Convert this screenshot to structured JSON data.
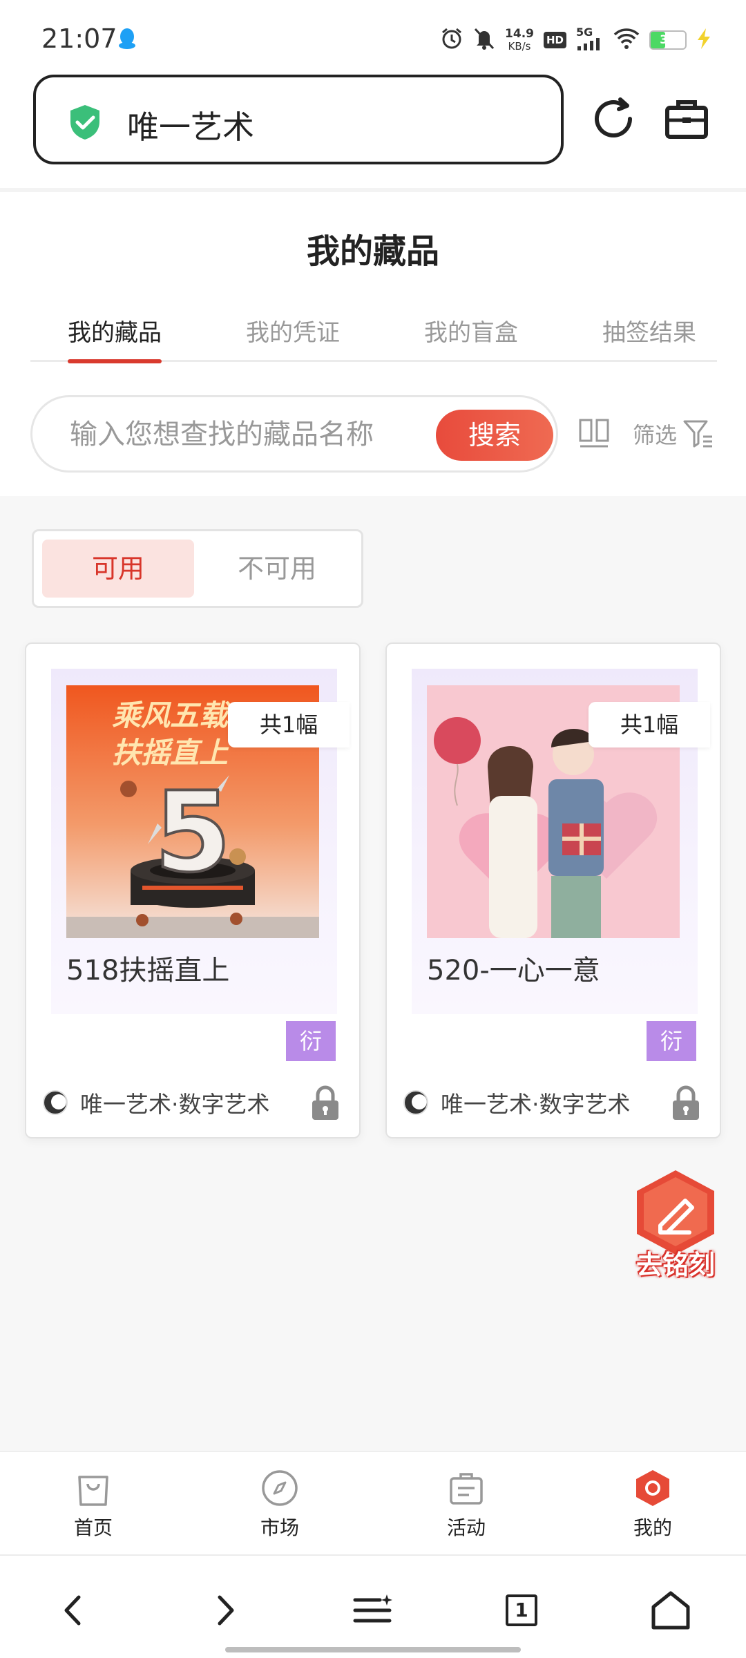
{
  "status_bar": {
    "time": "21:07",
    "speed_value": "14.9",
    "speed_unit": "KB/s",
    "hd_label": "HD",
    "network_label": "5G",
    "battery_level": "35",
    "icons": [
      "qq-icon",
      "alarm-icon",
      "mute-icon",
      "signal-icon",
      "wifi-icon",
      "battery-icon",
      "charging-icon"
    ]
  },
  "browser": {
    "site_title": "唯一艺术",
    "secure_icon": "shield-check-icon",
    "refresh_icon": "refresh-icon",
    "toolbox_icon": "briefcase-icon"
  },
  "page": {
    "title": "我的藏品"
  },
  "tabs": [
    {
      "label": "我的藏品",
      "active": true
    },
    {
      "label": "我的凭证",
      "active": false
    },
    {
      "label": "我的盲盒",
      "active": false
    },
    {
      "label": "抽签结果",
      "active": false
    }
  ],
  "search": {
    "placeholder": "输入您想查找的藏品名称",
    "button_label": "搜索",
    "filter_label": "筛选"
  },
  "segment": {
    "options": [
      {
        "label": "可用",
        "active": true
      },
      {
        "label": "不可用",
        "active": false
      }
    ]
  },
  "cards": [
    {
      "count_label": "共1幅",
      "image_text_1": "乘风五载",
      "image_text_2": "扶摇直上",
      "image_number": "5",
      "name": "518扶摇直上",
      "tag": "衍",
      "issuer": "唯一艺术·数字艺术"
    },
    {
      "count_label": "共1幅",
      "name": "520-一心一意",
      "tag": "衍",
      "issuer": "唯一艺术·数字艺术"
    }
  ],
  "floating": {
    "engrave_label": "去铭刻"
  },
  "app_nav": [
    {
      "label": "首页",
      "icon": "shopping-bag-icon",
      "active": false
    },
    {
      "label": "市场",
      "icon": "compass-icon",
      "active": false
    },
    {
      "label": "活动",
      "icon": "clipboard-icon",
      "active": false
    },
    {
      "label": "我的",
      "icon": "user-hexagon-icon",
      "active": true
    }
  ],
  "browser_nav": {
    "tab_count": "1",
    "icons": [
      "back-icon",
      "forward-icon",
      "menu-icon",
      "tabs-icon",
      "home-icon"
    ]
  },
  "colors": {
    "accent": "#d93a2e",
    "tag_purple": "#b98be8",
    "secure_green": "#3bbf7a"
  }
}
